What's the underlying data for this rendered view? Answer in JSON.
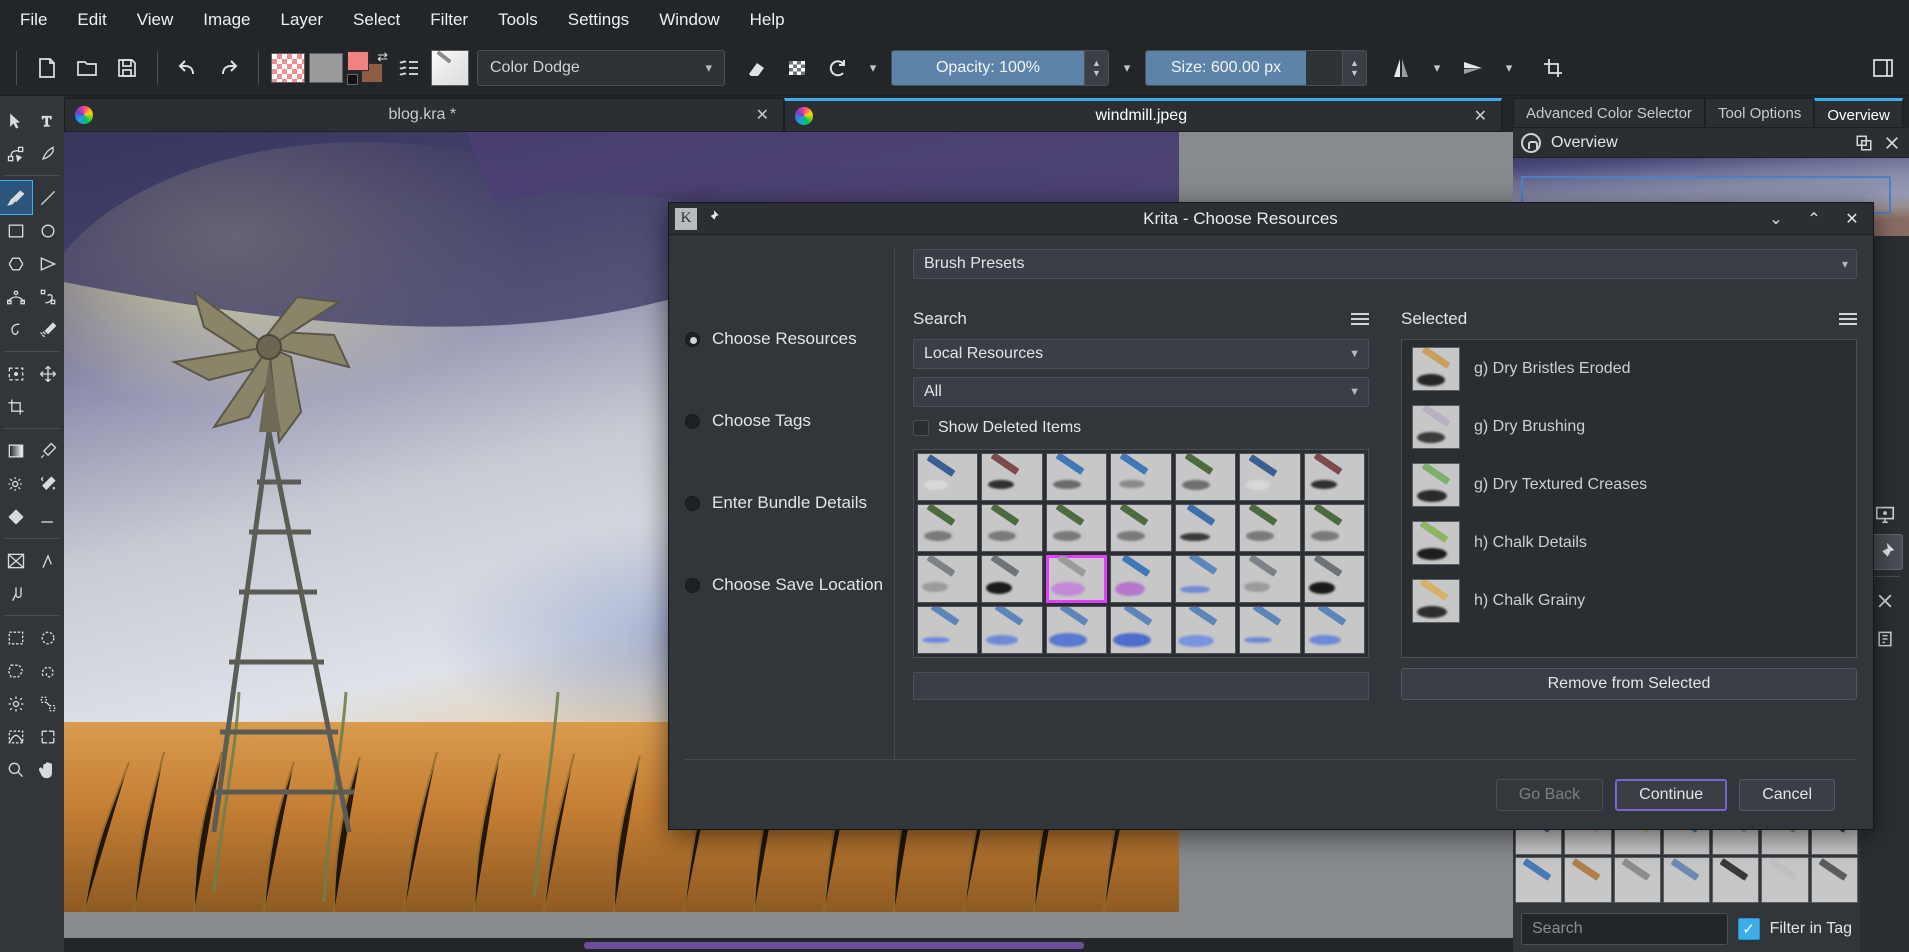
{
  "app": {
    "title": "Krita"
  },
  "menubar": {
    "items": [
      {
        "label": "File"
      },
      {
        "label": "Edit"
      },
      {
        "label": "View"
      },
      {
        "label": "Image"
      },
      {
        "label": "Layer"
      },
      {
        "label": "Select"
      },
      {
        "label": "Filter"
      },
      {
        "label": "Tools"
      },
      {
        "label": "Settings"
      },
      {
        "label": "Window"
      },
      {
        "label": "Help"
      }
    ]
  },
  "toolbar": {
    "new_icon": "new-document-icon",
    "open_icon": "open-folder-icon",
    "save_icon": "save-icon",
    "undo_icon": "undo-icon",
    "redo_icon": "redo-icon",
    "fg_color": "#f4827f",
    "bg_color": "#8d5c45",
    "blend_mode": "Color Dodge",
    "eraser_icon": "eraser-icon",
    "alpha_icon": "preserve-alpha-icon",
    "reload_icon": "reload-preset-icon",
    "opacity_label": "Opacity: 100%",
    "size_label": "Size: 600.00 px",
    "mirror_h_icon": "mirror-horizontal-icon",
    "mirror_v_icon": "mirror-vertical-icon",
    "wrap_icon": "wrap-around-icon",
    "workspace_icon": "workspace-icon"
  },
  "toolbox": {
    "tools": [
      {
        "name": "select-shapes-tool",
        "icon": "cursor-arrow-icon"
      },
      {
        "name": "text-tool",
        "icon": "text-icon"
      },
      {
        "name": "edit-shapes-tool",
        "icon": "edit-shapes-icon"
      },
      {
        "name": "calligraphy-tool",
        "icon": "calligraphy-icon"
      },
      {
        "name": "freehand-brush-tool",
        "icon": "paintbrush-icon",
        "selected": true
      },
      {
        "name": "line-tool",
        "icon": "line-icon"
      },
      {
        "name": "rectangle-tool",
        "icon": "rectangle-icon"
      },
      {
        "name": "ellipse-tool",
        "icon": "ellipse-icon"
      },
      {
        "name": "polygon-tool",
        "icon": "polygon-icon"
      },
      {
        "name": "polyline-tool",
        "icon": "polyline-icon"
      },
      {
        "name": "bezier-curve-tool",
        "icon": "bezier-curve-icon"
      },
      {
        "name": "freehand-path-tool",
        "icon": "freehand-path-icon"
      },
      {
        "name": "dynamic-brush-tool",
        "icon": "dynamic-brush-icon"
      },
      {
        "name": "multibrush-tool",
        "icon": "multibrush-icon"
      },
      {
        "name": "transform-tool",
        "icon": "transform-icon"
      },
      {
        "name": "move-tool",
        "icon": "move-icon"
      },
      {
        "name": "crop-tool",
        "icon": "crop-icon"
      },
      {
        "name": "gradient-tool",
        "icon": "gradient-icon"
      },
      {
        "name": "color-picker-tool",
        "icon": "eyedropper-icon"
      },
      {
        "name": "colorize-mask-tool",
        "icon": "colorize-mask-icon"
      },
      {
        "name": "smart-patch-tool",
        "icon": "smart-patch-icon"
      },
      {
        "name": "fill-tool",
        "icon": "fill-bucket-icon"
      },
      {
        "name": "assistant-tool",
        "icon": "assistant-icon"
      },
      {
        "name": "measure-tool",
        "icon": "measure-icon"
      },
      {
        "name": "reference-images-tool",
        "icon": "reference-images-icon"
      },
      {
        "name": "rect-select-tool",
        "icon": "rect-select-icon"
      },
      {
        "name": "ellipse-select-tool",
        "icon": "ellipse-select-icon"
      },
      {
        "name": "polygon-select-tool",
        "icon": "polygon-select-icon"
      },
      {
        "name": "freehand-select-tool",
        "icon": "freehand-select-icon"
      },
      {
        "name": "contiguous-select-tool",
        "icon": "contiguous-select-icon"
      },
      {
        "name": "similar-select-tool",
        "icon": "similar-select-icon"
      },
      {
        "name": "bezier-select-tool",
        "icon": "bezier-select-icon"
      },
      {
        "name": "magnetic-select-tool",
        "icon": "magnetic-select-icon"
      },
      {
        "name": "zoom-tool",
        "icon": "magnifier-icon"
      },
      {
        "name": "pan-tool",
        "icon": "hand-icon"
      }
    ]
  },
  "document_tabs": [
    {
      "label": "blog.kra *",
      "active": false,
      "close": "✕"
    },
    {
      "label": "windmill.jpeg",
      "active": true,
      "close": "✕"
    }
  ],
  "right_dock": {
    "tabs": [
      {
        "label": "Advanced Color Selector",
        "active": false
      },
      {
        "label": "Tool Options",
        "active": false
      },
      {
        "label": "Overview",
        "active": true
      }
    ],
    "panel_title": "Overview",
    "lock_icon": "lock-icon",
    "float_icon": "float-docker-icon",
    "close_icon": "close-icon",
    "strip_icons": [
      {
        "name": "display-settings-icon",
        "selected": false
      },
      {
        "name": "pin-icon",
        "selected": true
      },
      {
        "name": "close-icon",
        "selected": false
      },
      {
        "name": "notes-icon",
        "selected": false
      }
    ],
    "search_placeholder": "Search",
    "filter_in_tag_label": "Filter in Tag",
    "filter_in_tag_checked": true
  },
  "dialog": {
    "title": "Krita - Choose Resources",
    "app_icon": "krita-icon",
    "pin_icon": "pin-icon",
    "controls": [
      {
        "name": "minimize-button",
        "glyph": "⌄"
      },
      {
        "name": "maximize-button",
        "glyph": "⌃"
      },
      {
        "name": "close-button",
        "glyph": "✕"
      }
    ],
    "resource_type": "Brush Presets",
    "steps": [
      {
        "label": "Choose Resources",
        "active": true
      },
      {
        "label": "Choose Tags",
        "active": false
      },
      {
        "label": "Enter Bundle Details",
        "active": false
      },
      {
        "label": "Choose Save Location",
        "active": false
      }
    ],
    "left_panel": {
      "heading": "Search",
      "menu_icon": "hamburger-menu-icon",
      "source_dropdown": "Local Resources",
      "tag_dropdown": "All",
      "show_deleted_label": "Show Deleted Items",
      "show_deleted_checked": false
    },
    "right_panel": {
      "heading": "Selected",
      "menu_icon": "hamburger-menu-icon",
      "items": [
        {
          "label": "g) Dry Bristles Eroded"
        },
        {
          "label": "g) Dry Brushing"
        },
        {
          "label": "g) Dry Textured Creases"
        },
        {
          "label": "h) Chalk Details"
        },
        {
          "label": "h) Chalk Grainy"
        }
      ],
      "remove_button": "Remove from Selected"
    },
    "footer": {
      "go_back": "Go Back",
      "continue": "Continue",
      "cancel": "Cancel",
      "go_back_enabled": false
    },
    "accent": "#7a63c9",
    "selection_highlight": "#e040fb"
  }
}
